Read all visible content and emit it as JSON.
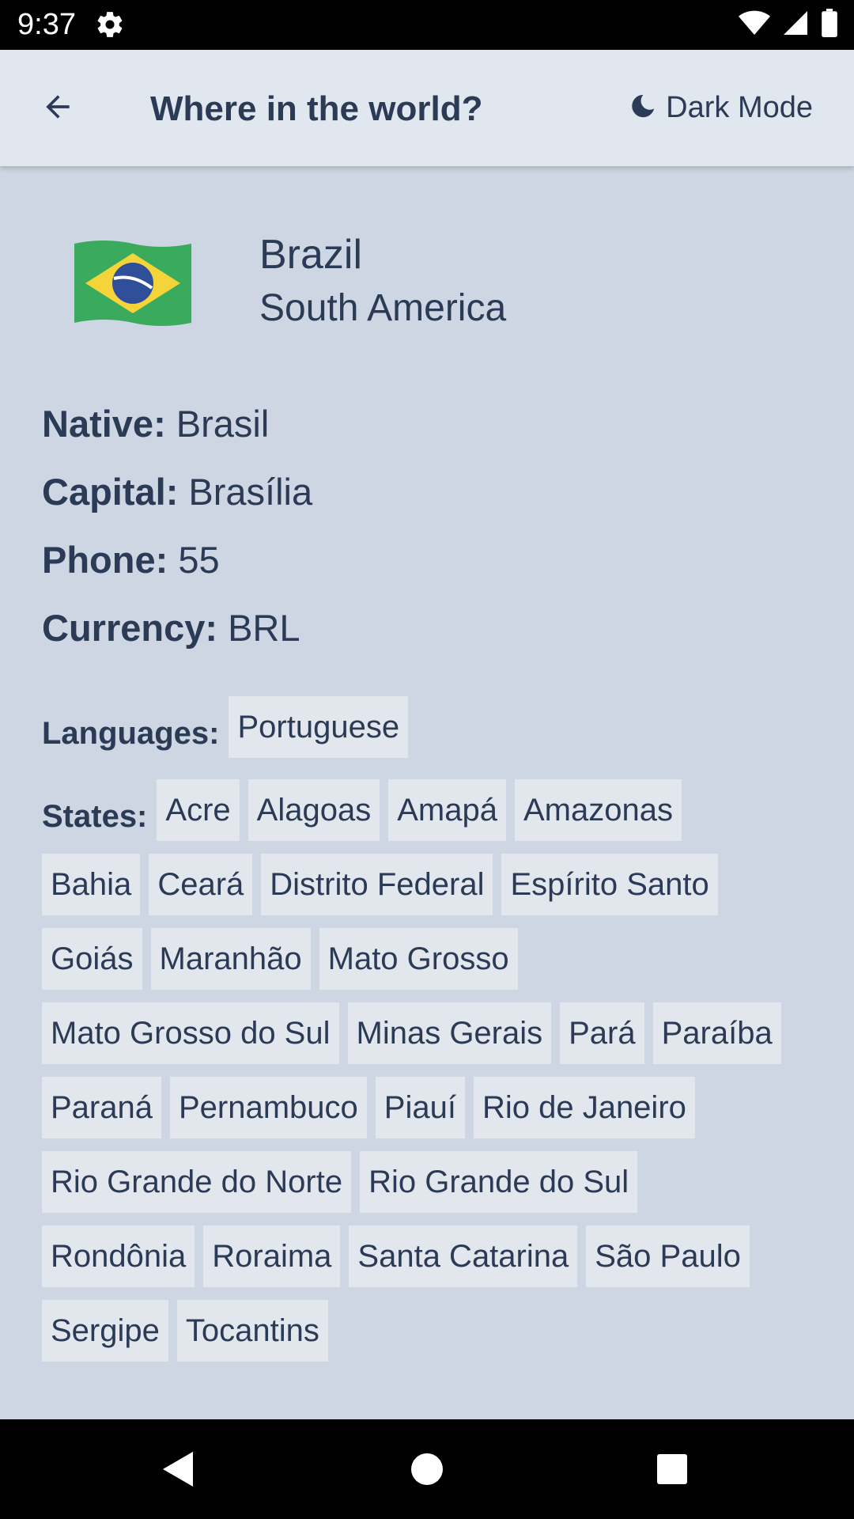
{
  "status_bar": {
    "time": "9:37"
  },
  "app_bar": {
    "title": "Where in the world?",
    "dark_mode_label": "Dark Mode"
  },
  "country": {
    "name": "Brazil",
    "region": "South America",
    "flag_icon": "brazil-flag-icon",
    "flag_colors": {
      "green": "#3aaa5c",
      "yellow": "#f5d43a",
      "blue": "#2f4f9b"
    },
    "details": [
      {
        "label": "Native:",
        "value": "Brasil"
      },
      {
        "label": "Capital:",
        "value": "Brasília"
      },
      {
        "label": "Phone:",
        "value": "55"
      },
      {
        "label": "Currency:",
        "value": "BRL"
      }
    ],
    "languages_label": "Languages:",
    "languages": [
      "Portuguese"
    ],
    "states_label": "States:",
    "states": [
      "Acre",
      "Alagoas",
      "Amapá",
      "Amazonas",
      "Bahia",
      "Ceará",
      "Distrito Federal",
      "Espírito Santo",
      "Goiás",
      "Maranhão",
      "Mato Grosso",
      "Mato Grosso do Sul",
      "Minas Gerais",
      "Pará",
      "Paraíba",
      "Paraná",
      "Pernambuco",
      "Piauí",
      "Rio de Janeiro",
      "Rio Grande do Norte",
      "Rio Grande do Sul",
      "Rondônia",
      "Roraima",
      "Santa Catarina",
      "São Paulo",
      "Sergipe",
      "Tocantins"
    ]
  },
  "colors": {
    "background": "#cdd6e2",
    "surface": "#e1e7ef",
    "text": "#2b3a55"
  }
}
